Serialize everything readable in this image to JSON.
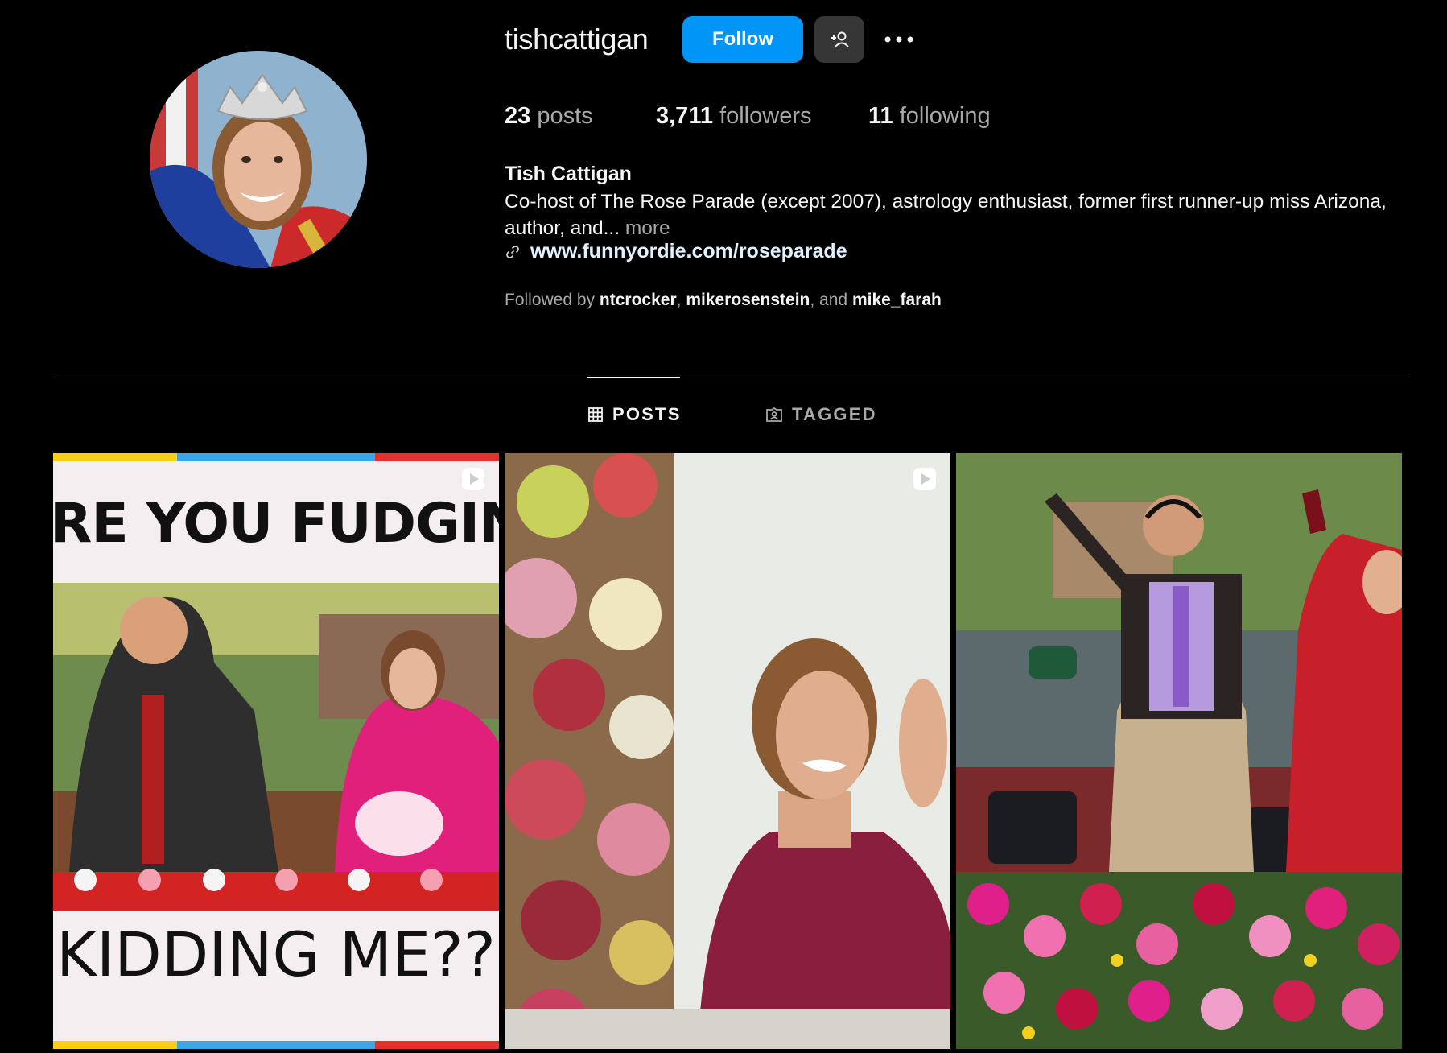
{
  "profile": {
    "username": "tishcattigan",
    "follow_label": "Follow",
    "full_name": "Tish Cattigan",
    "bio_text": "Co-host of The Rose Parade (except 2007), astrology enthusiast, former first runner-up miss Arizona, author, and...",
    "bio_more": "more",
    "link": "www.funnyordie.com/roseparade",
    "followed_by_prefix": "Followed by",
    "followed_by_users": [
      "ntcrocker",
      "mikerosenstein",
      "mike_farah"
    ],
    "followed_by_sep": ",",
    "followed_by_and": ", and"
  },
  "stats": {
    "posts_count": "23",
    "posts_label": "posts",
    "followers_count": "3,711",
    "followers_label": "followers",
    "following_count": "11",
    "following_label": "following"
  },
  "tabs": [
    {
      "label": "POSTS",
      "active": true,
      "icon": "grid-icon"
    },
    {
      "label": "TAGGED",
      "active": false,
      "icon": "tagged-icon"
    }
  ],
  "posts": [
    {
      "type": "reel",
      "overlay_top": "RE YOU FUDGIN",
      "overlay_bottom": "KIDDING ME??"
    },
    {
      "type": "reel"
    },
    {
      "type": "image"
    }
  ],
  "colors": {
    "accent": "#0095f6",
    "background": "#000000",
    "secondary_text": "#a8a8a8",
    "link": "#e0f1ff"
  }
}
